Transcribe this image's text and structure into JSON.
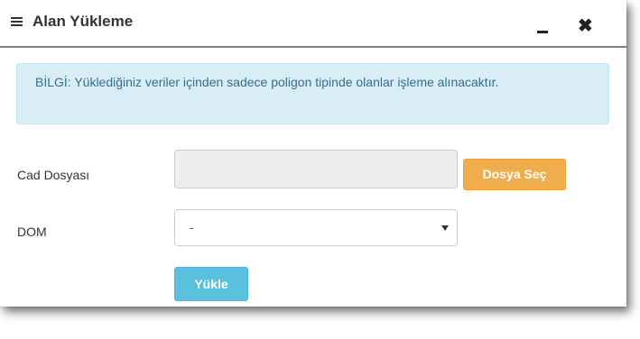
{
  "dialog": {
    "title": "Alan Yükleme",
    "menu_icon": "hamburger-menu-icon",
    "minimize_icon": "minimize-icon",
    "close_icon": "close-icon",
    "close_glyph": "✖"
  },
  "info_alert": {
    "text": "BİLGİ: Yüklediğiniz veriler içinden sadece poligon tipinde olanlar işleme alınacaktır."
  },
  "form": {
    "cad_label": "Cad Dosyası",
    "file_value": "",
    "file_button_label": "Dosya Seç",
    "dom_label": "DOM",
    "dom_selected": "-",
    "upload_button_label": "Yükle"
  },
  "colors": {
    "info_bg": "#d9edf7",
    "info_text": "#31708f",
    "file_button": "#f0ad4e",
    "upload_button": "#5bc0de"
  }
}
